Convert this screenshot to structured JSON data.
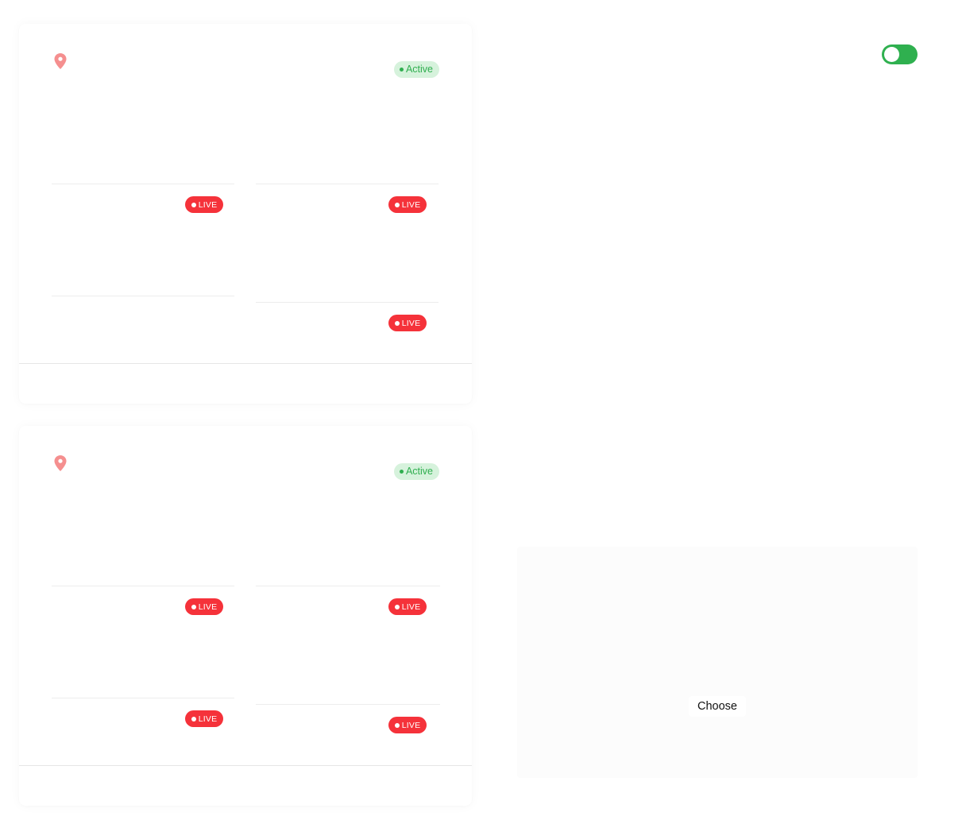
{
  "colors": {
    "active_bg": "#d6f2dc",
    "active_fg": "#2fae4f",
    "live_bg": "#f5323a",
    "pin": "#f58f8f",
    "toggle_on": "#2fb04f"
  },
  "locations": [
    {
      "status": "Active",
      "icon": "location-pin-icon",
      "cameras": [
        {
          "badge": "LIVE"
        },
        {
          "badge": "LIVE"
        },
        {
          "badge": "LIVE"
        }
      ]
    },
    {
      "status": "Active",
      "icon": "location-pin-icon",
      "cameras": [
        {
          "badge": "LIVE"
        },
        {
          "badge": "LIVE"
        },
        {
          "badge": "LIVE"
        },
        {
          "badge": "LIVE"
        }
      ]
    }
  ],
  "toggle": {
    "on": true
  },
  "upload": {
    "button_label": "Choose"
  }
}
